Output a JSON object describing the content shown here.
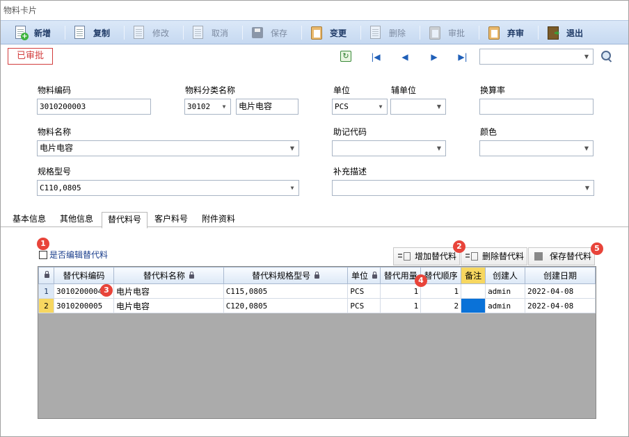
{
  "window": {
    "title": "物料卡片"
  },
  "toolbar": {
    "new": "新增",
    "copy": "复制",
    "edit": "修改",
    "cancel": "取消",
    "save": "保存",
    "change": "变更",
    "delete": "删除",
    "approve": "审批",
    "abandon": "弃审",
    "exit": "退出"
  },
  "status": {
    "label": "已审批",
    "color": "#d23c3c"
  },
  "form": {
    "material_code": {
      "label": "物料编码",
      "value": "3010200003"
    },
    "category_name": {
      "label": "物料分类名称",
      "code": "30102",
      "name": "电片电容"
    },
    "unit": {
      "label": "单位",
      "value": "PCS"
    },
    "aux_unit": {
      "label": "辅单位",
      "value": ""
    },
    "conversion_rate": {
      "label": "换算率",
      "value": ""
    },
    "material_name": {
      "label": "物料名称",
      "value": "电片电容"
    },
    "mnemonic_code": {
      "label": "助记代码",
      "value": ""
    },
    "color": {
      "label": "颜色",
      "value": ""
    },
    "spec_model": {
      "label": "规格型号",
      "value": "C110,0805"
    },
    "supplement": {
      "label": "补充描述",
      "value": ""
    }
  },
  "tabs": [
    {
      "label": "基本信息"
    },
    {
      "label": "其他信息"
    },
    {
      "label": "替代料号",
      "active": true
    },
    {
      "label": "客户料号"
    },
    {
      "label": "附件资料"
    }
  ],
  "substitute": {
    "edit_checkbox_label": "是否编辑替代料",
    "add_button": "增加替代料",
    "delete_button": "删除替代料",
    "save_button": "保存替代料",
    "markers": [
      "1",
      "2",
      "3",
      "4",
      "5"
    ],
    "columns": [
      "替代料编码",
      "替代料名称",
      "替代料规格型号",
      "单位",
      "替代用量",
      "替代顺序",
      "备注",
      "创建人",
      "创建日期"
    ],
    "rows": [
      {
        "no": "1",
        "code": "3010200004",
        "name": "电片电容",
        "spec": "C115,0805",
        "unit": "PCS",
        "qty": "1",
        "order": "1",
        "note": "",
        "creator": "admin",
        "date": "2022-04-08"
      },
      {
        "no": "2",
        "code": "3010200005",
        "name": "电片电容",
        "spec": "C120,0805",
        "unit": "PCS",
        "qty": "1",
        "order": "2",
        "note": "",
        "creator": "admin",
        "date": "2022-04-08"
      }
    ]
  },
  "icons": {
    "new": "new-doc-icon",
    "copy": "copy-icon",
    "edit": "edit-icon",
    "cancel": "cancel-icon",
    "save": "save-disk-icon",
    "change": "clipboard-icon",
    "delete": "delete-icon",
    "approve": "approve-icon",
    "abandon": "abandon-icon",
    "exit": "exit-door-icon"
  }
}
